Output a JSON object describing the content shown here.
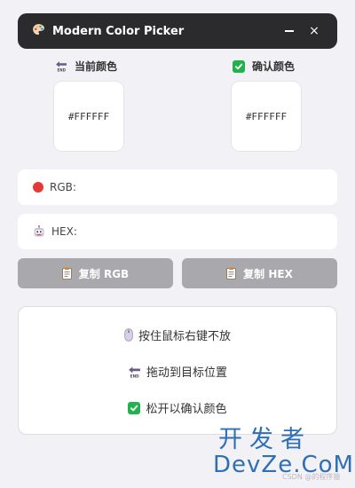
{
  "window": {
    "title": "Modern Color Picker",
    "minimize_icon": "minimize-icon",
    "close_label": "×"
  },
  "current_color": {
    "label": "当前颜色",
    "icon": "back-end-arrow-icon",
    "value": "#FFFFFF"
  },
  "confirmed_color": {
    "label": "确认颜色",
    "icon": "check-box-icon",
    "value": "#FFFFFF"
  },
  "rgb_field": {
    "label": "RGB:",
    "value": "",
    "icon": "red-circle-icon"
  },
  "hex_field": {
    "label": "HEX:",
    "value": "",
    "icon": "robot-face-icon"
  },
  "buttons": {
    "copy_rgb": "复制 RGB",
    "copy_hex": "复制 HEX"
  },
  "instructions": [
    {
      "text": "按住鼠标右键不放",
      "icon": "mouse-icon"
    },
    {
      "text": "拖动到目标位置",
      "icon": "back-end-arrow-icon"
    },
    {
      "text": "松开以确认颜色",
      "icon": "check-box-icon"
    }
  ],
  "watermark": {
    "cn": "开发者",
    "en": "DevZe.CoM",
    "small": "CSDN @的程序猿"
  },
  "colors": {
    "titlebar": "#2b2b2e",
    "background": "#f2f2f6",
    "button": "#a8a8ad",
    "check_green": "#22b24c",
    "rgb_dot": "#e53935",
    "icon_purple": "#6a5a8c",
    "watermark": "#2f6fb6"
  }
}
